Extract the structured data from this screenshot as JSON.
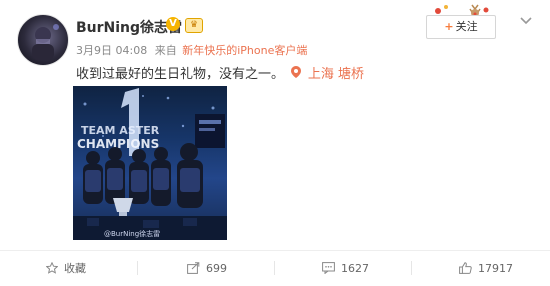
{
  "post": {
    "author": "BurNing徐志雷",
    "date": "3月9日 04:08",
    "from_label": "来自",
    "client": "新年快乐的iPhone客户端",
    "text": "收到过最好的生日礼物，没有之一。",
    "location": "上海 塘桥",
    "image_watermark": "@BurNing徐志雷",
    "image_text": "TEAM ASTER CHAMPIONS"
  },
  "follow_button": {
    "label": "关注"
  },
  "actions": {
    "favorite_label": "收藏",
    "repost_count": "699",
    "comment_count": "1627",
    "like_count": "17917"
  },
  "icons": {
    "verified": "verified-v-badge-icon",
    "member": "member-crown-badge-icon",
    "more": "chevron-down-icon",
    "location": "location-pin-icon",
    "favorite": "star-icon",
    "repost": "share-arrow-icon",
    "comment": "speech-bubble-icon",
    "like": "thumbs-up-icon"
  },
  "colors": {
    "accent": "#eb7350",
    "follow_plus": "#f77c3d",
    "verified": "#f6b400",
    "muted": "#888888"
  }
}
